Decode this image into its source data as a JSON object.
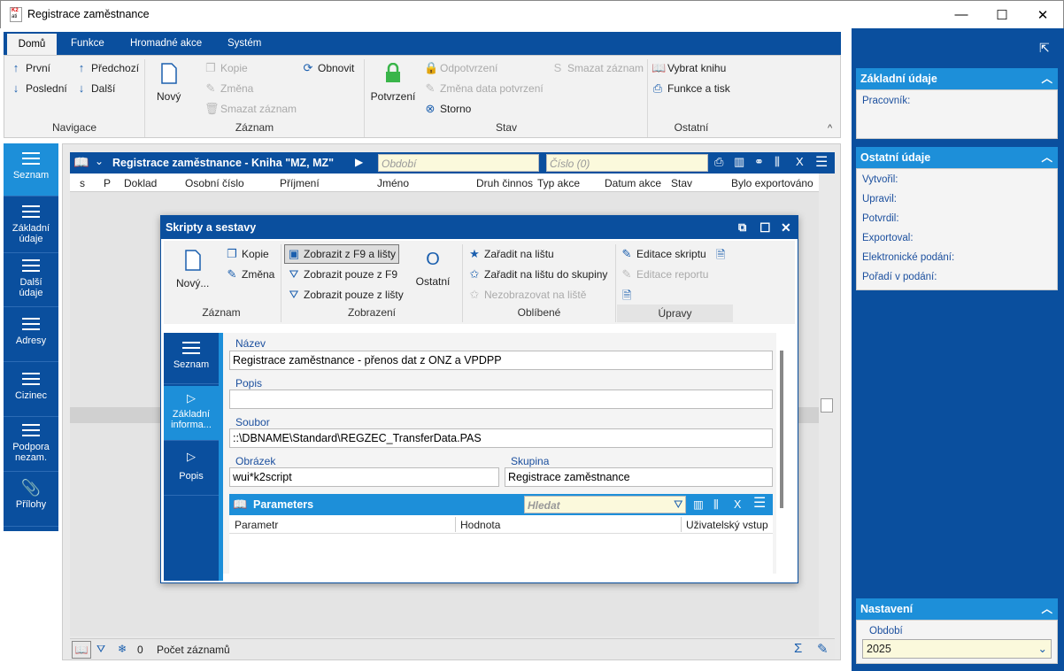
{
  "window": {
    "title": "Registrace zaměstnance",
    "logo_text": "K2 ati"
  },
  "ribbon": {
    "tabs": [
      {
        "label": "Domů"
      },
      {
        "label": "Funkce"
      },
      {
        "label": "Hromadné akce"
      },
      {
        "label": "Systém"
      }
    ],
    "nav": {
      "first": "První",
      "last": "Poslední",
      "prev": "Předchozí",
      "next": "Další",
      "group": "Navigace"
    },
    "record": {
      "new": "Nový",
      "copy": "Kopie",
      "change": "Změna",
      "delete": "Smazat záznam",
      "refresh": "Obnovit",
      "group": "Záznam"
    },
    "state": {
      "confirm": "Potvrzení",
      "unconfirm": "Odpotvrzení",
      "change_date": "Změna data potvrzení",
      "cancel": "Storno",
      "delete": "Smazat záznam",
      "group": "Stav"
    },
    "other": {
      "select_book": "Vybrat knihu",
      "func_print": "Funkce a tisk",
      "group": "Ostatní"
    }
  },
  "leftnav": [
    {
      "label": "Seznam"
    },
    {
      "label": "Základní údaje"
    },
    {
      "label": "Další údaje"
    },
    {
      "label": "Adresy"
    },
    {
      "label": "Cizinec"
    },
    {
      "label": "Podpora nezam."
    },
    {
      "label": "Přílohy"
    }
  ],
  "grid": {
    "title": "Registrace zaměstnance - Kniha \"MZ, MZ\"",
    "period_placeholder": "Období",
    "number_placeholder": "Číslo (0)",
    "columns": [
      "s",
      "P",
      "Doklad",
      "Osobní číslo",
      "Příjmení",
      "Jméno",
      "Druh činnos",
      "Typ akce",
      "Datum akce",
      "Stav",
      "Bylo exportováno"
    ],
    "record_count": "0",
    "record_count_label": "Počet záznamů"
  },
  "right": {
    "basic": {
      "title": "Základní údaje",
      "worker": "Pracovník:"
    },
    "other": {
      "title": "Ostatní údaje",
      "fields": [
        "Vytvořil:",
        "Upravil:",
        "Potvrdil:",
        "Exportoval:",
        "Elektronické podání:",
        "Pořadí v podání:"
      ]
    },
    "settings": {
      "title": "Nastavení",
      "period_label": "Období",
      "period_value": "2025"
    }
  },
  "dialog": {
    "title": "Skripty a sestavy",
    "ribbon": {
      "new": "Nový...",
      "copy": "Kopie",
      "change": "Změna",
      "group_record": "Záznam",
      "show_f9_bar": "Zobrazit z F9 a lišty",
      "show_f9": "Zobrazit pouze z F9",
      "show_bar": "Zobrazit pouze z lišty",
      "other": "Ostatní",
      "group_view": "Zobrazení",
      "add_bar": "Zařadit na lištu",
      "add_bar_group": "Zařadit na lištu do skupiny",
      "hide_bar": "Nezobrazovat na liště",
      "group_fav": "Oblíbené",
      "edit_script": "Editace skriptu",
      "edit_report": "Editace reportu",
      "group_edit": "Úpravy"
    },
    "nav": [
      {
        "label": "Seznam"
      },
      {
        "label": "Základní informa..."
      },
      {
        "label": "Popis"
      }
    ],
    "form": {
      "name_label": "Název",
      "name_value": "Registrace zaměstnance - přenos dat z ONZ a VPDPP",
      "desc_label": "Popis",
      "desc_value": "",
      "file_label": "Soubor",
      "file_value": "::\\DBNAME\\Standard\\REGZEC_TransferData.PAS",
      "image_label": "Obrázek",
      "image_value": "wui*k2script",
      "group_label": "Skupina",
      "group_value": "Registrace zaměstnance"
    },
    "params": {
      "title": "Parameters",
      "search_placeholder": "Hledat",
      "columns": [
        "Parametr",
        "Hodnota",
        "Uživatelský vstup"
      ]
    }
  }
}
